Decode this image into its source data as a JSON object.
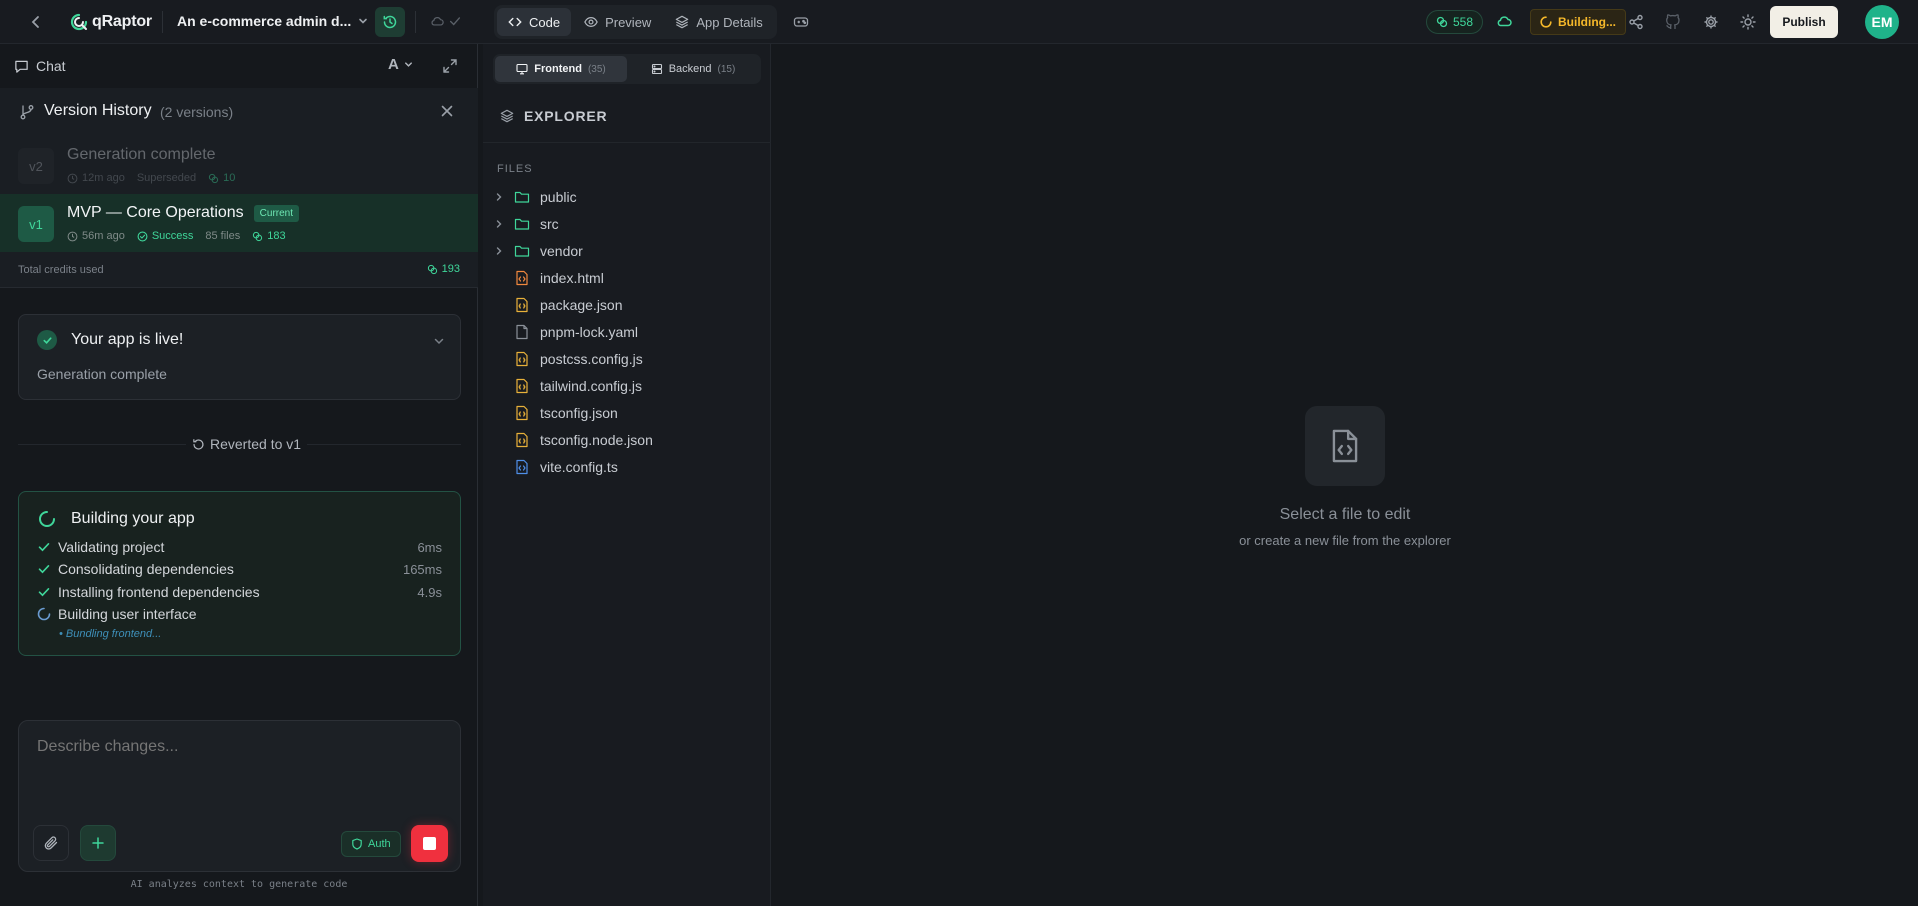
{
  "app": {
    "logo_text": "qRaptor",
    "project_title": "An e-commerce admin d..."
  },
  "view_tabs": [
    {
      "label": "Code",
      "icon": "code-icon",
      "active": true
    },
    {
      "label": "Preview",
      "icon": "eye-icon",
      "active": false
    },
    {
      "label": "App Details",
      "icon": "layers-icon",
      "active": false
    }
  ],
  "status": {
    "credits": "558",
    "building_label": "Building...",
    "publish_label": "Publish",
    "avatar_initials": "EM"
  },
  "chat": {
    "header_label": "Chat",
    "font_button_label": "A"
  },
  "version_history": {
    "title": "Version History",
    "count_label": "(2 versions)",
    "versions": [
      {
        "badge": "v2",
        "name": "Generation complete",
        "time": "12m ago",
        "status": "Superseded",
        "credits": "10"
      },
      {
        "badge": "v1",
        "name": "MVP — Core Operations",
        "current_label": "Current",
        "time": "56m ago",
        "status": "Success",
        "files": "85 files",
        "credits": "183"
      }
    ],
    "total_label": "Total credits used",
    "total_value": "193"
  },
  "live_card": {
    "title": "Your app is live!",
    "subtitle": "Generation complete"
  },
  "reverted_label": "Reverted to v1",
  "build_card": {
    "title": "Building your app",
    "steps": [
      {
        "label": "Validating project",
        "time": "6ms",
        "state": "done"
      },
      {
        "label": "Consolidating dependencies",
        "time": "165ms",
        "state": "done"
      },
      {
        "label": "Installing frontend dependencies",
        "time": "4.9s",
        "state": "done"
      },
      {
        "label": "Building user interface",
        "time": "",
        "state": "running"
      }
    ],
    "substep": "• Bundling frontend..."
  },
  "composer": {
    "placeholder": "Describe changes...",
    "auth_label": "Auth",
    "footer_note": "AI analyzes context to generate code"
  },
  "explorer": {
    "tabs": [
      {
        "label": "Frontend",
        "count": "(35)",
        "active": true
      },
      {
        "label": "Backend",
        "count": "(15)",
        "active": false
      }
    ],
    "title": "EXPLORER",
    "files_label": "FILES",
    "items": [
      {
        "name": "public",
        "type": "folder"
      },
      {
        "name": "src",
        "type": "folder"
      },
      {
        "name": "vendor",
        "type": "folder"
      },
      {
        "name": "index.html",
        "type": "html"
      },
      {
        "name": "package.json",
        "type": "json"
      },
      {
        "name": "pnpm-lock.yaml",
        "type": "plain"
      },
      {
        "name": "postcss.config.js",
        "type": "js"
      },
      {
        "name": "tailwind.config.js",
        "type": "js"
      },
      {
        "name": "tsconfig.json",
        "type": "json"
      },
      {
        "name": "tsconfig.node.json",
        "type": "json"
      },
      {
        "name": "vite.config.ts",
        "type": "ts"
      }
    ]
  },
  "editor": {
    "empty_title": "Select a file to edit",
    "empty_subtitle": "or create a new file from the explorer"
  },
  "colors": {
    "accent_green": "#3fd69a",
    "warning_amber": "#f5b82a",
    "stop_red": "#f0303e",
    "folder_green": "#3fd69a",
    "json_yellow": "#e8b13a",
    "html_orange": "#f0883e",
    "ts_blue": "#4f8fe8"
  }
}
